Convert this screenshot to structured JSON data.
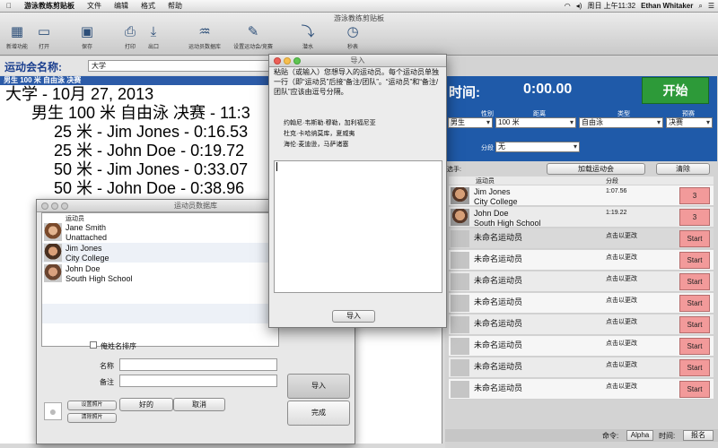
{
  "menubar": {
    "app_name": "游泳教练剪贴板",
    "menus": [
      "文件",
      "编辑",
      "格式",
      "帮助"
    ],
    "clock": "周日 上午11:32",
    "user": "Ethan Whitaker"
  },
  "window": {
    "title": "游泳教练剪贴板"
  },
  "toolbar": {
    "items": [
      {
        "label": "新增功能",
        "icon": "new-features-icon"
      },
      {
        "label": "打开",
        "icon": "folder-icon"
      },
      {
        "label": "保存",
        "icon": "save-icon"
      },
      {
        "label": "打印",
        "icon": "printer-icon"
      },
      {
        "label": "出口",
        "icon": "export-icon"
      },
      {
        "label": "运动员数据库",
        "icon": "swimmer-icon"
      },
      {
        "label": "设置运动会/竞赛",
        "icon": "settings-icon"
      },
      {
        "label": "潜水",
        "icon": "dive-icon"
      },
      {
        "label": "秒表",
        "icon": "stopwatch-icon"
      }
    ]
  },
  "meet": {
    "label": "运动会名称:",
    "name": "大学",
    "event_bar": "男生 100 米 自由泳 决赛"
  },
  "results": {
    "lines": [
      "大学 - 10月 27, 2013",
      "男生 100 米 自由泳 决赛 - 11:3",
      "25 米 - Jim Jones - 0:16.53",
      "25 米 - John Doe - 0:19.72",
      "50 米 - Jim Jones - 0:33.07",
      "50 米 - John Doe - 0:38.96"
    ]
  },
  "timer": {
    "label": "时间:",
    "value": "0:00.00",
    "start_label": "开始"
  },
  "filters": {
    "gender_label": "性别",
    "gender_value": "男生",
    "distance_label": "距离",
    "distance_value": "100 米",
    "stroke_label": "类型",
    "stroke_value": "自由泳",
    "round_label": "预赛",
    "round_value": "决赛",
    "split_label": "分段",
    "split_value": "无",
    "swimmers_label": "选手:",
    "load_meet_label": "加载运动会",
    "clear_label": "清除"
  },
  "lanes": {
    "col_athlete": "运动员",
    "col_split": "分段",
    "rows": [
      {
        "name": "Jim Jones",
        "team": "City College",
        "split": "1:07.56",
        "button": "3"
      },
      {
        "name": "John Doe",
        "team": "South High School",
        "split": "1:19.22",
        "button": "3"
      },
      {
        "name": "未命名运动员",
        "team": "",
        "split": "点击以更改",
        "button": "Start"
      },
      {
        "name": "未命名运动员",
        "team": "",
        "split": "点击以更改",
        "button": "Start"
      },
      {
        "name": "未命名运动员",
        "team": "",
        "split": "点击以更改",
        "button": "Start"
      },
      {
        "name": "未命名运动员",
        "team": "",
        "split": "点击以更改",
        "button": "Start"
      },
      {
        "name": "未命名运动员",
        "team": "",
        "split": "点击以更改",
        "button": "Start"
      },
      {
        "name": "未命名运动员",
        "team": "",
        "split": "点击以更改",
        "button": "Start"
      },
      {
        "name": "未命名运动员",
        "team": "",
        "split": "点击以更改",
        "button": "Start"
      },
      {
        "name": "未命名运动员",
        "team": "",
        "split": "点击以更改",
        "button": "Start"
      }
    ]
  },
  "bottom": {
    "order_label": "命令:",
    "alpha_label": "Alpha",
    "time_label": "时间:",
    "rank_label": "报名"
  },
  "athlete_db": {
    "title": "运动员数据库",
    "col_athlete": "运动员",
    "athletes": [
      {
        "name": "Jane Smith",
        "team": "Unattached"
      },
      {
        "name": "Jim Jones",
        "team": "City College"
      },
      {
        "name": "John Doe",
        "team": "South High School"
      }
    ],
    "sort_label": "俺姓名排序",
    "name_label": "名称",
    "note_label": "备注",
    "set_photo": "设置照片",
    "clear_photo": "清除照片",
    "ok_label": "好的",
    "cancel_label": "取消",
    "import_label": "导入",
    "done_label": "完成"
  },
  "import_dialog": {
    "title": "导入",
    "instructions": "粘贴（或输入）您想导入的运动员。每个运动员单独一行（即“运动员”后接“备注/团队”。“运动员”和“备注/团队”应该由逗号分隔。",
    "example_1": "约翰尼·韦斯勒·穆勒，加利福尼亚",
    "example_2": "杜克·卡哈纳莫库，夏威夷",
    "example_3": "海伦·麦迪逊，马萨诸塞",
    "import_button": "导入"
  }
}
